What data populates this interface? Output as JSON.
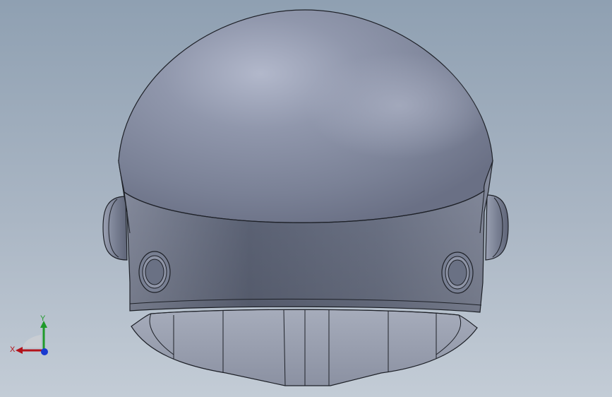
{
  "viewport": {
    "background_top": "#8fa0b2",
    "background_bottom": "#c3ccd6",
    "model": {
      "name": "helmet",
      "shell_color": "#8b93a7",
      "shade_color": "#6b7285",
      "edge_color": "#1e2128"
    }
  },
  "triad": {
    "x_label": "X",
    "y_label": "Y",
    "x_color": "#b3121a",
    "y_color": "#1f9a2a",
    "z_color": "#1a3ad0"
  }
}
